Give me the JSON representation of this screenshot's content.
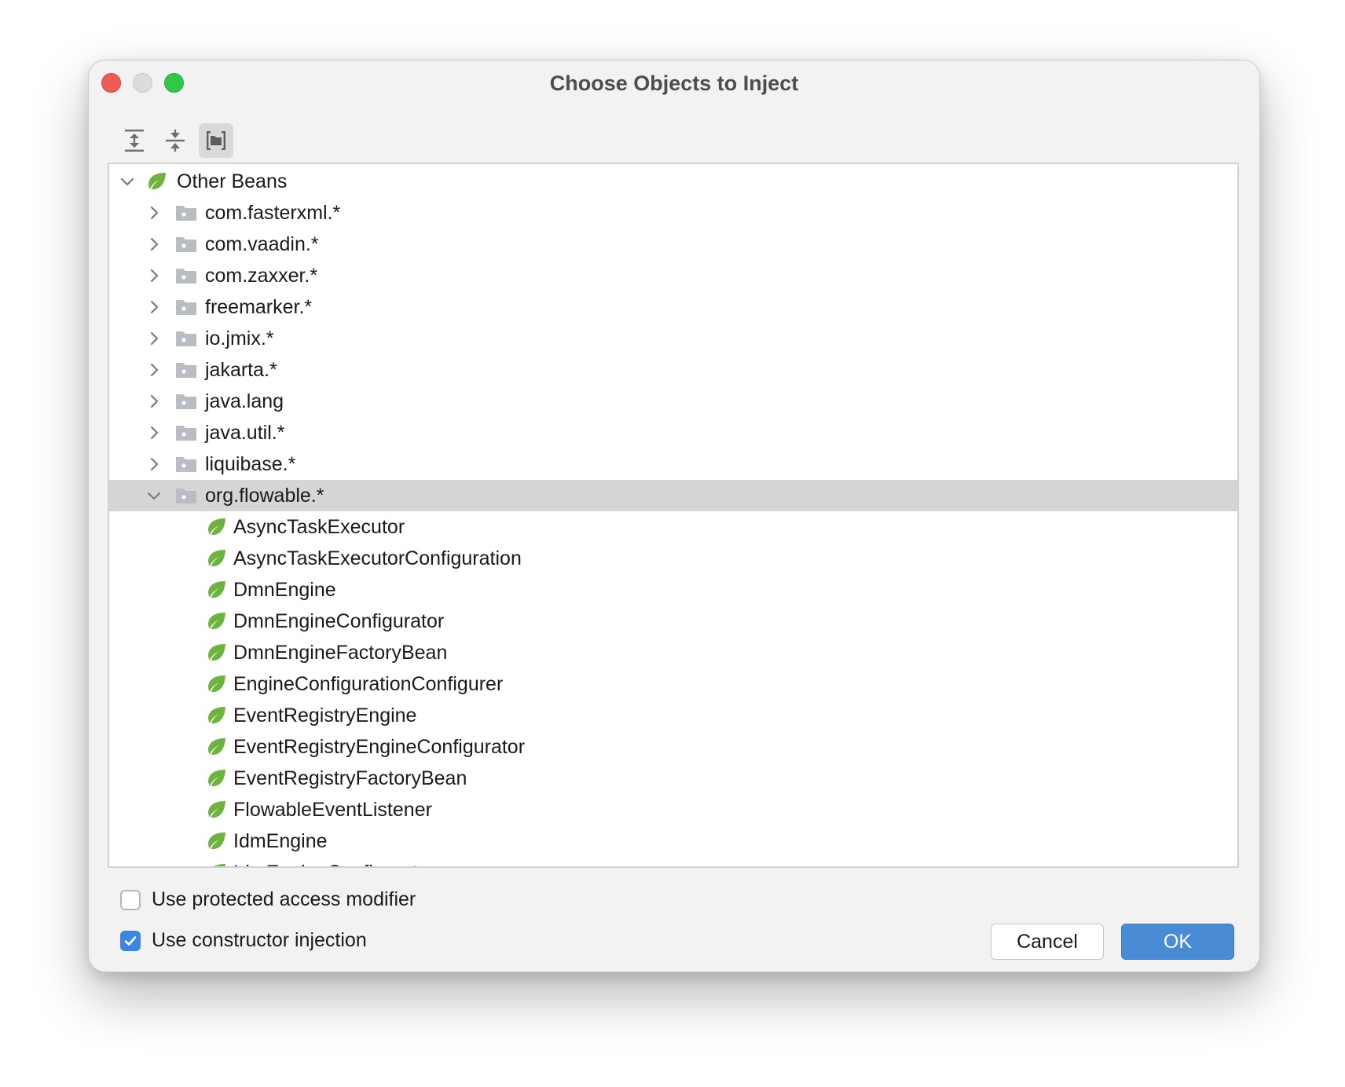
{
  "window": {
    "title": "Choose Objects to Inject"
  },
  "toolbar": {
    "buttons": [
      {
        "icon": "expand-all-icon"
      },
      {
        "icon": "collapse-all-icon"
      },
      {
        "icon": "group-by-package-icon",
        "active": true
      }
    ]
  },
  "tree": {
    "root": {
      "label": "Other Beans",
      "expanded": true,
      "icon": "spring-bean-icon"
    },
    "packages": [
      {
        "label": "com.fasterxml.*",
        "expanded": false
      },
      {
        "label": "com.vaadin.*",
        "expanded": false
      },
      {
        "label": "com.zaxxer.*",
        "expanded": false
      },
      {
        "label": "freemarker.*",
        "expanded": false
      },
      {
        "label": "io.jmix.*",
        "expanded": false
      },
      {
        "label": "jakarta.*",
        "expanded": false
      },
      {
        "label": "java.lang",
        "expanded": false
      },
      {
        "label": "java.util.*",
        "expanded": false
      },
      {
        "label": "liquibase.*",
        "expanded": false
      },
      {
        "label": "org.flowable.*",
        "expanded": true,
        "selected": true
      }
    ],
    "beans": [
      "AsyncTaskExecutor",
      "AsyncTaskExecutorConfiguration",
      "DmnEngine",
      "DmnEngineConfigurator",
      "DmnEngineFactoryBean",
      "EngineConfigurationConfigurer",
      "EventRegistryEngine",
      "EventRegistryEngineConfigurator",
      "EventRegistryFactoryBean",
      "FlowableEventListener",
      "IdmEngine",
      "IdmEngineConfigurator"
    ]
  },
  "options": {
    "protected_label": "Use protected access modifier",
    "protected_checked": false,
    "constructor_label": "Use constructor injection",
    "constructor_checked": true
  },
  "buttons": {
    "cancel": "Cancel",
    "ok": "OK"
  },
  "colors": {
    "accent": "#4a8bd6",
    "spring_green": "#6db33f",
    "folder": "#b9bdc3"
  }
}
